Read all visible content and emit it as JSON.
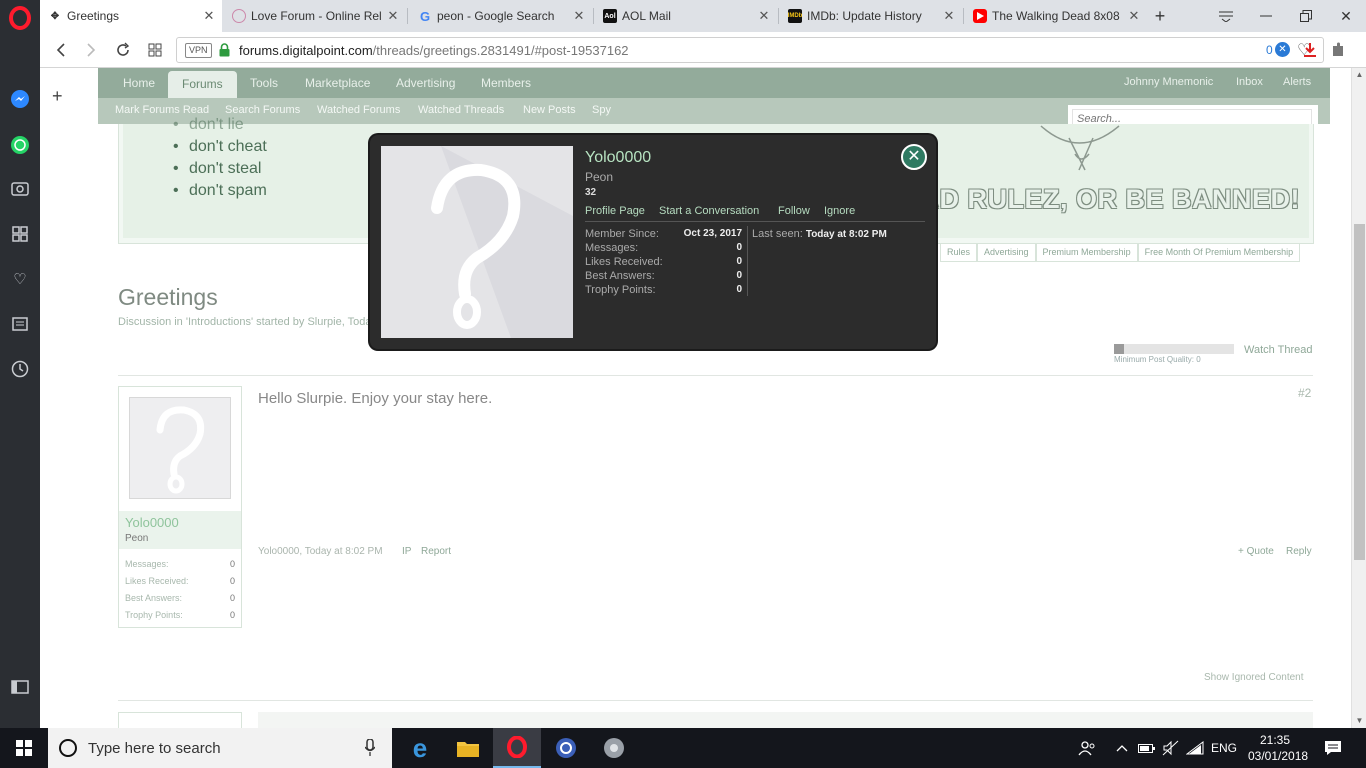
{
  "browser": {
    "tabs": [
      {
        "title": "Greetings",
        "active": true
      },
      {
        "title": "Love Forum - Online Rel",
        "active": false
      },
      {
        "title": "peon - Google Search",
        "active": false
      },
      {
        "title": "AOL Mail",
        "active": false
      },
      {
        "title": "IMDb: Update History",
        "active": false
      },
      {
        "title": "The Walking Dead 8x08",
        "active": false
      }
    ],
    "vpn_label": "VPN",
    "url_domain": "forums.digitalpoint.com",
    "url_path": "/threads/greetings.2831491/#post-19537162",
    "adblock_count": "0"
  },
  "site": {
    "nav": [
      "Home",
      "Forums",
      "Tools",
      "Marketplace",
      "Advertising",
      "Members"
    ],
    "nav_right": [
      "Johnny Mnemonic",
      "Inbox",
      "Alerts"
    ],
    "subnav": [
      "Mark Forums Read",
      "Search Forums",
      "Watched Forums",
      "Watched Threads",
      "New Posts",
      "Spy"
    ],
    "search_placeholder": "Search...",
    "banner_rules": [
      "don't lie",
      "don't cheat",
      "don't steal",
      "don't spam"
    ],
    "banner_slogan": "READ RULEZ, OR BE BANNED!",
    "banner_tabs": [
      "Rules",
      "Advertising",
      "Premium Membership",
      "Free Month Of Premium Membership"
    ]
  },
  "thread": {
    "title": "Greetings",
    "meta": "Discussion in 'Introductions' started by Slurpie, Toda",
    "quality_label": "Minimum Post Quality: 0",
    "quality_fraction": 0.08,
    "watch_label": "Watch Thread"
  },
  "post": {
    "username": "Yolo0000",
    "user_title": "Peon",
    "stats": [
      {
        "label": "Messages:",
        "value": "0"
      },
      {
        "label": "Likes Received:",
        "value": "0"
      },
      {
        "label": "Best Answers:",
        "value": "0"
      },
      {
        "label": "Trophy Points:",
        "value": "0"
      }
    ],
    "message": "Hello Slurpie. Enjoy your stay here.",
    "number": "#2",
    "footer_meta": "Yolo0000, Today at 8:02 PM",
    "ip_label": "IP",
    "report_label": "Report",
    "quote_label": "+ Quote",
    "reply_label": "Reply",
    "show_ignored": "Show Ignored Content"
  },
  "popup": {
    "username": "Yolo0000",
    "user_title": "Peon",
    "score": "32",
    "links": [
      "Profile Page",
      "Start a Conversation",
      "Follow",
      "Ignore"
    ],
    "info": [
      {
        "label": "Member Since:",
        "value": "Oct 23, 2017"
      },
      {
        "label": "Messages:",
        "value": "0"
      },
      {
        "label": "Likes Received:",
        "value": "0"
      },
      {
        "label": "Best Answers:",
        "value": "0"
      },
      {
        "label": "Trophy Points:",
        "value": "0"
      }
    ],
    "last_seen_label": "Last seen:",
    "last_seen_value": "Today at 8:02 PM"
  },
  "taskbar": {
    "search_placeholder": "Type here to search",
    "language": "ENG",
    "time": "21:35",
    "date": "03/01/2018"
  }
}
